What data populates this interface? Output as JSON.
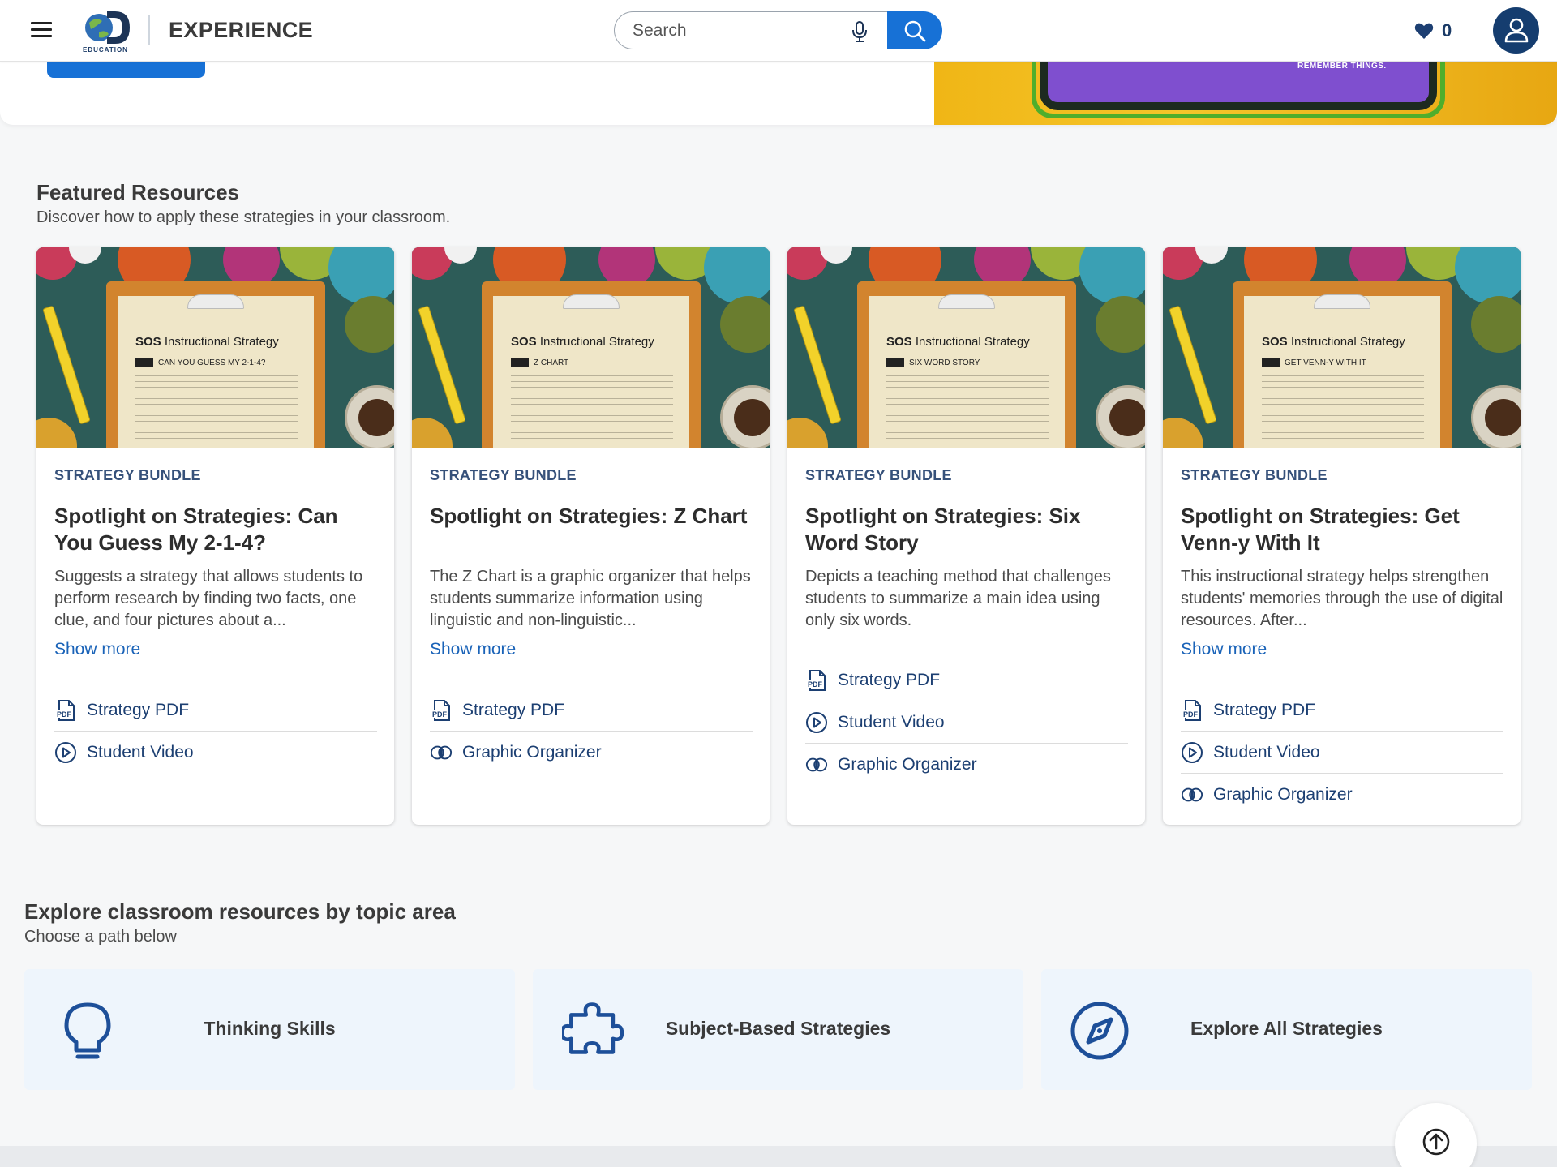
{
  "header": {
    "logo_text": "EDUCATION",
    "brand": "EXPERIENCE",
    "search_placeholder": "Search",
    "favorites_count": "0"
  },
  "hero": {
    "image_text": "REMEMBER THINGS."
  },
  "featured": {
    "title": "Featured Resources",
    "subtitle": "Discover how to apply these strategies in your classroom.",
    "cards": [
      {
        "image": {
          "sos_bold": "SOS",
          "sos_rest": " Instructional Strategy",
          "strategy": "CAN YOU GUESS MY 2-1-4?"
        },
        "tag": "STRATEGY BUNDLE",
        "title": "Spotlight on Strategies: Can You Guess My 2-1-4?",
        "description": "Suggests a strategy that allows students to perform research by finding two facts, one clue, and four pictures about a...",
        "show_more": "Show more",
        "links": [
          "Strategy PDF",
          "Student Video"
        ]
      },
      {
        "image": {
          "sos_bold": "SOS",
          "sos_rest": " Instructional Strategy",
          "strategy": "Z CHART"
        },
        "tag": "STRATEGY BUNDLE",
        "title": "Spotlight on Strategies: Z Chart",
        "description": "The Z Chart is a graphic organizer that helps students summarize information using linguistic and non-linguistic...",
        "show_more": "Show more",
        "links": [
          "Strategy PDF",
          "Graphic Organizer"
        ]
      },
      {
        "image": {
          "sos_bold": "SOS",
          "sos_rest": " Instructional Strategy",
          "strategy": "SIX WORD STORY"
        },
        "tag": "STRATEGY BUNDLE",
        "title": "Spotlight on Strategies: Six Word Story",
        "description": "Depicts a teaching method that challenges students to summarize a main idea using only six words.",
        "links": [
          "Strategy PDF",
          "Student Video",
          "Graphic Organizer"
        ]
      },
      {
        "image": {
          "sos_bold": "SOS",
          "sos_rest": " Instructional Strategy",
          "strategy": "GET VENN-Y WITH IT"
        },
        "tag": "STRATEGY BUNDLE",
        "title": "Spotlight on Strategies: Get Venn-y With It",
        "description": "This instructional strategy helps strengthen students' memories through the use of digital resources. After...",
        "show_more": "Show more",
        "links": [
          "Strategy PDF",
          "Student Video",
          "Graphic Organizer"
        ]
      }
    ]
  },
  "topics": {
    "title": "Explore classroom resources by topic area",
    "subtitle": "Choose a path below",
    "items": [
      {
        "label": "Thinking Skills",
        "icon": "lightbulb-icon"
      },
      {
        "label": "Subject-Based Strategies",
        "icon": "puzzle-icon"
      },
      {
        "label": "Explore All Strategies",
        "icon": "compass-icon"
      }
    ]
  },
  "colors": {
    "accent": "#1771d6",
    "navy": "#153d6f",
    "link": "#1a63b8",
    "topic_bg": "#eef5fc"
  }
}
